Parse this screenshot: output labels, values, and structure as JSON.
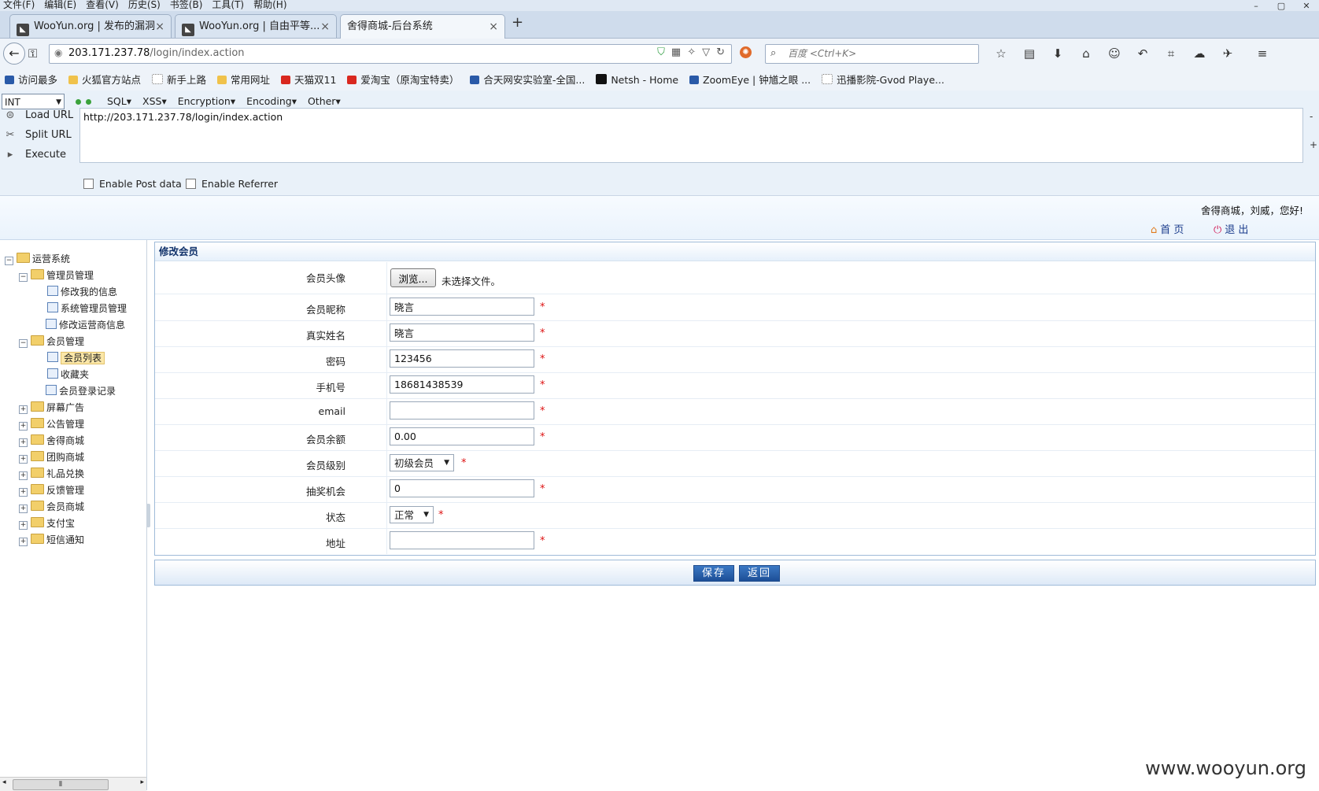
{
  "menu": [
    "文件(F)",
    "编辑(E)",
    "查看(V)",
    "历史(S)",
    "书签(B)",
    "工具(T)",
    "帮助(H)"
  ],
  "window_controls": [
    "–",
    "▢",
    "✕"
  ],
  "tabs": [
    {
      "label": "WooYun.org | 发布的漏洞"
    },
    {
      "label": "WooYun.org | 自由平等..."
    },
    {
      "label": "舍得商城-后台系统"
    }
  ],
  "address": {
    "host": "203.171.237.78",
    "path": "/login/index.action"
  },
  "search": {
    "placeholder": "百度 <Ctrl+K>"
  },
  "bookmarks": [
    "访问最多",
    "火狐官方站点",
    "新手上路",
    "常用网址",
    "天猫双11",
    "爱淘宝（原淘宝特卖）",
    "合天网安实验室-全国...",
    "Netsh - Home",
    "ZoomEye | 钟馗之眼 ...",
    "迅播影院-Gvod Playe..."
  ],
  "hackbar": {
    "type_select": "INT",
    "menus": [
      "SQL",
      "XSS",
      "Encryption",
      "Encoding",
      "Other"
    ],
    "load_url": "Load URL",
    "split_url": "Split URL",
    "execute": "Execute",
    "url": "http://203.171.237.78/login/index.action",
    "enable_post": "Enable Post data",
    "enable_referrer": "Enable Referrer"
  },
  "header": {
    "greeting": "舍得商城，刘威，您好!",
    "home": "首 页",
    "logout": "退 出"
  },
  "tree": {
    "root": "运营系统",
    "admin": "管理员管理",
    "admin_items": [
      "修改我的信息",
      "系统管理员管理",
      "修改运营商信息"
    ],
    "member": "会员管理",
    "member_items": [
      "会员列表",
      "收藏夹",
      "会员登录记录"
    ],
    "others": [
      "屏幕广告",
      "公告管理",
      "舍得商城",
      "团购商城",
      "礼品兑换",
      "反馈管理",
      "会员商城",
      "支付宝",
      "短信通知"
    ]
  },
  "form": {
    "title": "修改会员",
    "avatar_label": "会员头像",
    "browse": "浏览...",
    "no_file": "未选择文件。",
    "nickname_label": "会员昵称",
    "nickname": "晓言",
    "realname_label": "真实姓名",
    "realname": "晓言",
    "password_label": "密码",
    "password": "123456",
    "phone_label": "手机号",
    "phone": "18681438539",
    "email_label": "email",
    "email": "",
    "balance_label": "会员余额",
    "balance": "0.00",
    "level_label": "会员级别",
    "level": "初级会员",
    "lottery_label": "抽奖机会",
    "lottery": "0",
    "status_label": "状态",
    "status": "正常",
    "address_label": "地址",
    "address": "",
    "required_mark": "*",
    "save": "保存",
    "back": "返回"
  },
  "watermark": "www.wooyun.org"
}
